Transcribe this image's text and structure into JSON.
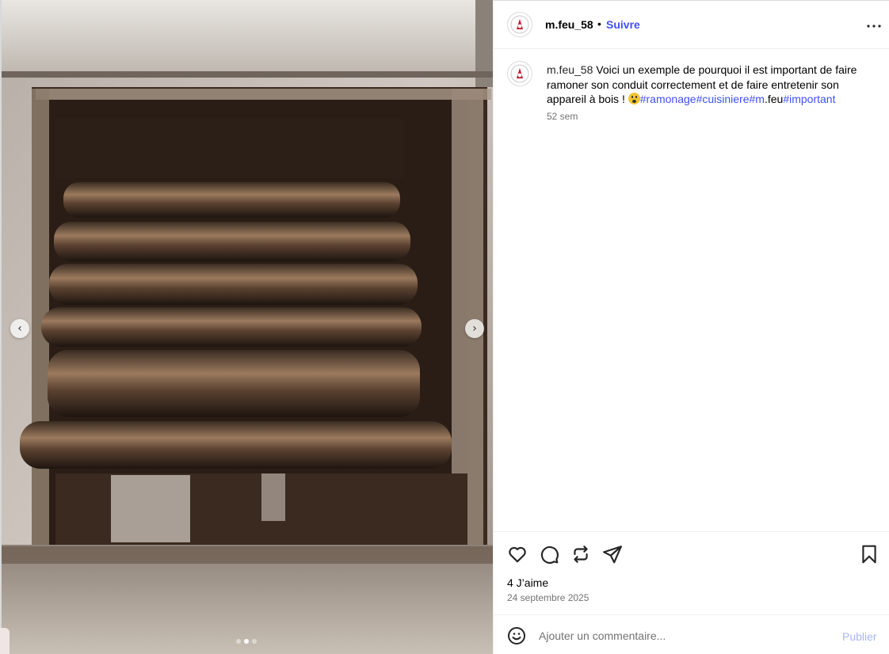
{
  "post": {
    "username": "m.feu_58",
    "separator": "•",
    "follow_label": "Suivre"
  },
  "caption": {
    "username": "m.feu_58",
    "text": " Voici un exemple de pourquoi il est important de faire ramoner son conduit correctement et de faire entretenir son appareil à bois ! ",
    "hashtags": [
      "#ramonage",
      "#cuisiniere",
      "#m",
      "#important"
    ],
    "plain_fragment": ".feu",
    "age": "52 sem"
  },
  "stats": {
    "likes": "4 J’aime",
    "date": "24 septembre 2025"
  },
  "comment": {
    "placeholder": "Ajouter un commentaire...",
    "publish_label": "Publier"
  },
  "carousel": {
    "total_slides": 3,
    "current_slide": 2
  },
  "icons": {
    "more": "more-horizontal-icon",
    "like": "heart-icon",
    "comment": "comment-icon",
    "repost": "repost-icon",
    "share": "send-icon",
    "save": "bookmark-icon",
    "emoji": "smiley-icon",
    "prev": "chevron-left-icon",
    "next": "chevron-right-icon"
  },
  "colors": {
    "accent": "#4150f7",
    "muted": "#737373",
    "publish_disabled": "#aab6f7"
  }
}
